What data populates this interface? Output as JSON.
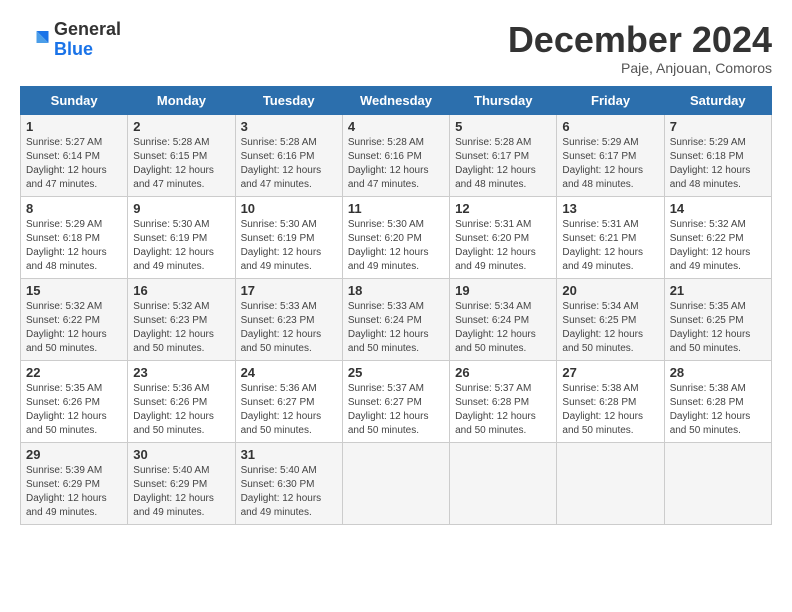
{
  "header": {
    "logo_general": "General",
    "logo_blue": "Blue",
    "month_year": "December 2024",
    "location": "Paje, Anjouan, Comoros"
  },
  "weekdays": [
    "Sunday",
    "Monday",
    "Tuesday",
    "Wednesday",
    "Thursday",
    "Friday",
    "Saturday"
  ],
  "weeks": [
    [
      {
        "day": 1,
        "rise": "5:27 AM",
        "set": "6:14 PM",
        "hours": "12 hours and 47 minutes."
      },
      {
        "day": 2,
        "rise": "5:28 AM",
        "set": "6:15 PM",
        "hours": "12 hours and 47 minutes."
      },
      {
        "day": 3,
        "rise": "5:28 AM",
        "set": "6:16 PM",
        "hours": "12 hours and 47 minutes."
      },
      {
        "day": 4,
        "rise": "5:28 AM",
        "set": "6:16 PM",
        "hours": "12 hours and 47 minutes."
      },
      {
        "day": 5,
        "rise": "5:28 AM",
        "set": "6:17 PM",
        "hours": "12 hours and 48 minutes."
      },
      {
        "day": 6,
        "rise": "5:29 AM",
        "set": "6:17 PM",
        "hours": "12 hours and 48 minutes."
      },
      {
        "day": 7,
        "rise": "5:29 AM",
        "set": "6:18 PM",
        "hours": "12 hours and 48 minutes."
      }
    ],
    [
      {
        "day": 8,
        "rise": "5:29 AM",
        "set": "6:18 PM",
        "hours": "12 hours and 48 minutes."
      },
      {
        "day": 9,
        "rise": "5:30 AM",
        "set": "6:19 PM",
        "hours": "12 hours and 49 minutes."
      },
      {
        "day": 10,
        "rise": "5:30 AM",
        "set": "6:19 PM",
        "hours": "12 hours and 49 minutes."
      },
      {
        "day": 11,
        "rise": "5:30 AM",
        "set": "6:20 PM",
        "hours": "12 hours and 49 minutes."
      },
      {
        "day": 12,
        "rise": "5:31 AM",
        "set": "6:20 PM",
        "hours": "12 hours and 49 minutes."
      },
      {
        "day": 13,
        "rise": "5:31 AM",
        "set": "6:21 PM",
        "hours": "12 hours and 49 minutes."
      },
      {
        "day": 14,
        "rise": "5:32 AM",
        "set": "6:22 PM",
        "hours": "12 hours and 49 minutes."
      }
    ],
    [
      {
        "day": 15,
        "rise": "5:32 AM",
        "set": "6:22 PM",
        "hours": "12 hours and 50 minutes."
      },
      {
        "day": 16,
        "rise": "5:32 AM",
        "set": "6:23 PM",
        "hours": "12 hours and 50 minutes."
      },
      {
        "day": 17,
        "rise": "5:33 AM",
        "set": "6:23 PM",
        "hours": "12 hours and 50 minutes."
      },
      {
        "day": 18,
        "rise": "5:33 AM",
        "set": "6:24 PM",
        "hours": "12 hours and 50 minutes."
      },
      {
        "day": 19,
        "rise": "5:34 AM",
        "set": "6:24 PM",
        "hours": "12 hours and 50 minutes."
      },
      {
        "day": 20,
        "rise": "5:34 AM",
        "set": "6:25 PM",
        "hours": "12 hours and 50 minutes."
      },
      {
        "day": 21,
        "rise": "5:35 AM",
        "set": "6:25 PM",
        "hours": "12 hours and 50 minutes."
      }
    ],
    [
      {
        "day": 22,
        "rise": "5:35 AM",
        "set": "6:26 PM",
        "hours": "12 hours and 50 minutes."
      },
      {
        "day": 23,
        "rise": "5:36 AM",
        "set": "6:26 PM",
        "hours": "12 hours and 50 minutes."
      },
      {
        "day": 24,
        "rise": "5:36 AM",
        "set": "6:27 PM",
        "hours": "12 hours and 50 minutes."
      },
      {
        "day": 25,
        "rise": "5:37 AM",
        "set": "6:27 PM",
        "hours": "12 hours and 50 minutes."
      },
      {
        "day": 26,
        "rise": "5:37 AM",
        "set": "6:28 PM",
        "hours": "12 hours and 50 minutes."
      },
      {
        "day": 27,
        "rise": "5:38 AM",
        "set": "6:28 PM",
        "hours": "12 hours and 50 minutes."
      },
      {
        "day": 28,
        "rise": "5:38 AM",
        "set": "6:28 PM",
        "hours": "12 hours and 50 minutes."
      }
    ],
    [
      {
        "day": 29,
        "rise": "5:39 AM",
        "set": "6:29 PM",
        "hours": "12 hours and 49 minutes."
      },
      {
        "day": 30,
        "rise": "5:40 AM",
        "set": "6:29 PM",
        "hours": "12 hours and 49 minutes."
      },
      {
        "day": 31,
        "rise": "5:40 AM",
        "set": "6:30 PM",
        "hours": "12 hours and 49 minutes."
      },
      null,
      null,
      null,
      null
    ]
  ],
  "labels": {
    "sunrise": "Sunrise:",
    "sunset": "Sunset:",
    "daylight": "Daylight:"
  }
}
